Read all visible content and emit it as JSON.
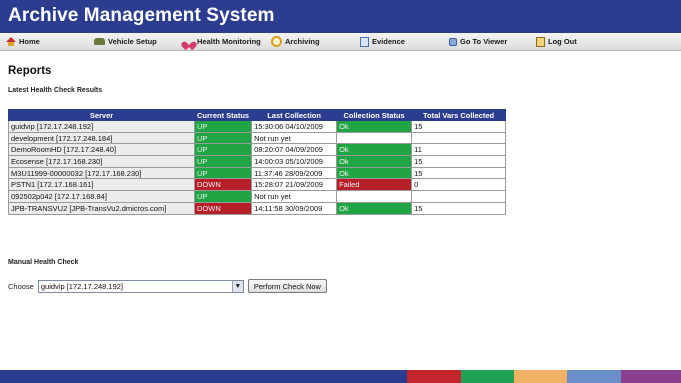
{
  "app": {
    "title": "Archive Management System"
  },
  "nav": [
    {
      "label": "Home",
      "icon": "home-icon"
    },
    {
      "label": "Vehicle Setup",
      "icon": "car-icon"
    },
    {
      "label": "Health Monitoring",
      "icon": "heart-icon"
    },
    {
      "label": "Archiving",
      "icon": "magnifier-icon"
    },
    {
      "label": "Evidence",
      "icon": "document-icon"
    },
    {
      "label": "Go To Viewer",
      "icon": "viewer-icon"
    },
    {
      "label": "Log Out",
      "icon": "logout-icon"
    }
  ],
  "page": {
    "heading": "Reports",
    "latest_label": "Latest Health Check Results",
    "manual_label": "Manual Health Check"
  },
  "table": {
    "headers": [
      "Server",
      "Current Status",
      "Last Collection",
      "Collection Status",
      "Total Vars Collected"
    ],
    "rows": [
      {
        "server": "guidvip [172.17.248.192]",
        "status": "UP",
        "last": "15:30:06 04/10/2009",
        "cstatus": "Ok",
        "vars": "15"
      },
      {
        "server": "development [172.17.248.184]",
        "status": "UP",
        "last": "Not run yet",
        "cstatus": "",
        "vars": ""
      },
      {
        "server": "DemoRoomHD [172.17.248.40]",
        "status": "UP",
        "last": "08:20:07 04/09/2009",
        "cstatus": "Ok",
        "vars": "11"
      },
      {
        "server": "Ecosense [172.17.168.230]",
        "status": "UP",
        "last": "14:00:03 05/10/2009",
        "cstatus": "Ok",
        "vars": "15"
      },
      {
        "server": "M3U11999-00000032 [172.17.168.230]",
        "status": "UP",
        "last": "11:37:46 28/09/2009",
        "cstatus": "Ok",
        "vars": "15"
      },
      {
        "server": "PSTN1 [172.17.168.161]",
        "status": "DOWN",
        "last": "15:28:07 21/09/2009",
        "cstatus": "Failed",
        "vars": "0"
      },
      {
        "server": "092502p042 [172.17.168.84]",
        "status": "UP",
        "last": "Not run yet",
        "cstatus": "",
        "vars": ""
      },
      {
        "server": "JPB-TRANSVU2 [JPB-TransVu2.dmicros.com]",
        "status": "DOWN",
        "last": "14:11:58 30/09/2009",
        "cstatus": "Ok",
        "vars": "15"
      }
    ]
  },
  "manual": {
    "choose_label": "Choose",
    "selected": "guidvip [172.17.248.192]",
    "button": "Perform Check Now"
  },
  "colors": {
    "brand": "#2c3d8f",
    "up": "#1fa544",
    "down": "#b61f28",
    "footer": [
      "#2c3d8f",
      "#c3262d",
      "#1fa255",
      "#f2b266",
      "#6b8fc9",
      "#8a3f8f"
    ]
  }
}
